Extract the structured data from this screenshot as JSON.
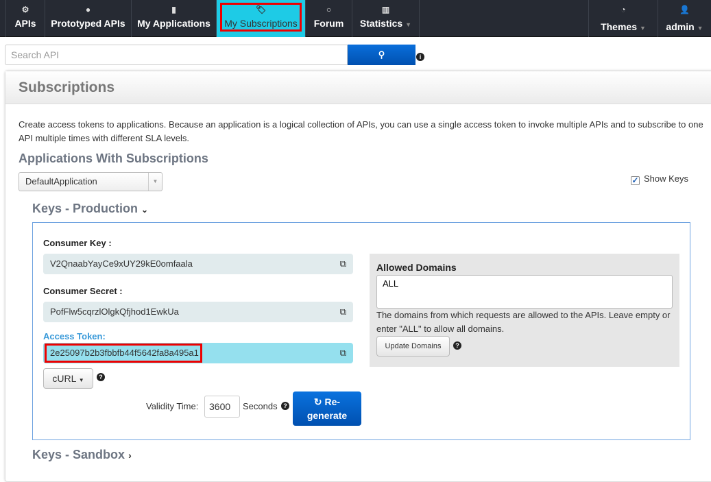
{
  "nav": {
    "items": [
      {
        "label": "APIs",
        "icon": "cogs-icon"
      },
      {
        "label": "Prototyped APIs",
        "icon": "gear-icon"
      },
      {
        "label": "My Applications",
        "icon": "briefcase-icon"
      },
      {
        "label": "My Subscriptions",
        "icon": "tags-icon",
        "active": true
      },
      {
        "label": "Forum",
        "icon": "comment-icon"
      },
      {
        "label": "Statistics",
        "icon": "bar-chart-icon"
      }
    ],
    "themes": "Themes",
    "user": "admin"
  },
  "search": {
    "placeholder": "Search API"
  },
  "page": {
    "title": "Subscriptions",
    "description": "Create access tokens to applications. Because an application is a logical collection of APIs, you can use a single access token to invoke multiple APIs and to subscribe to one API multiple times with different SLA levels.",
    "apps_heading": "Applications With Subscriptions",
    "selected_app": "DefaultApplication",
    "show_keys": "Show Keys",
    "prod_heading": "Keys - Production",
    "sandbox_heading": "Keys - Sandbox",
    "consumer_key_label": "Consumer Key :",
    "consumer_key": "V2QnaabYayCe9xUY29kE0omfaala",
    "consumer_secret_label": "Consumer Secret :",
    "consumer_secret": "PofFlw5cqrzlOlgkQfjhod1EwkUa",
    "access_token_label": "Access Token:",
    "access_token": "2e25097b2b3fbbfb44f5642fa8a495a1",
    "curl": "cURL",
    "validity_label": "Validity Time:",
    "validity": "3600",
    "seconds": "Seconds",
    "regen1": "Re-",
    "regen2": "generate",
    "domains_title": "Allowed Domains",
    "domains_value": "ALL",
    "domains_help": "The domains from which requests are allowed to the APIs. Leave empty or enter \"ALL\" to allow all domains.",
    "update_domains": "Update Domains"
  },
  "colors": {
    "nav_bg": "#262a33",
    "active_tab": "#1ecbe6",
    "highlight": "#ee0000",
    "primary": "#0a6fdb"
  }
}
